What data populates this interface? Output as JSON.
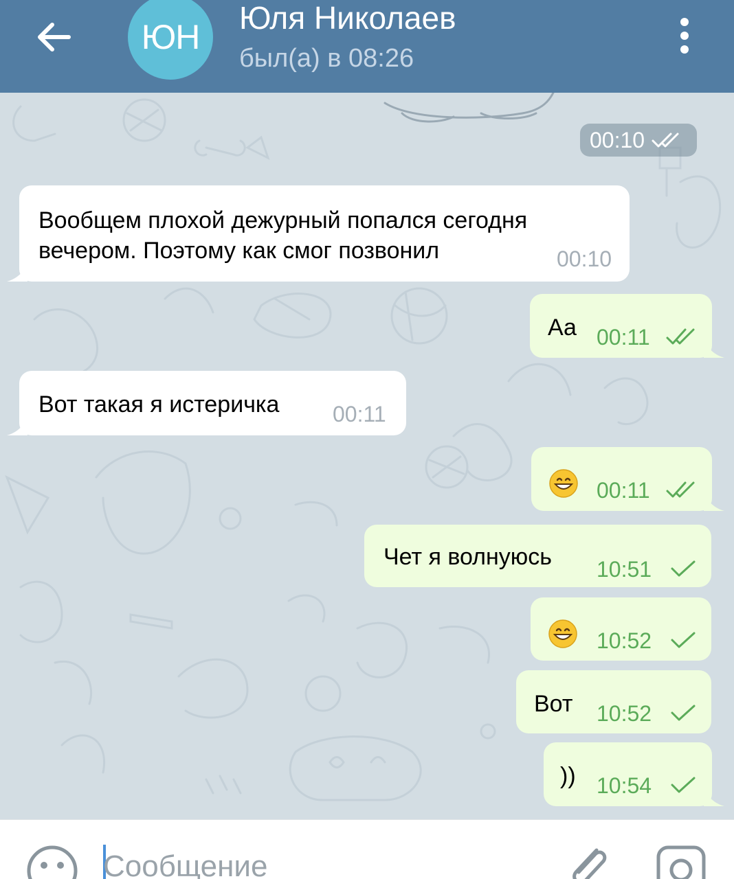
{
  "header": {
    "avatar_initials": "ЮН",
    "name": "Юля Николаев",
    "status": "был(а) в 08:26",
    "color": "#527da3",
    "avatar_color": "#5fbfd8",
    "icons": [
      "back-arrow-icon",
      "more-vertical-icon"
    ]
  },
  "messages": {
    "m0_time": "00:10",
    "m1": {
      "text_line1": "Вообщем плохой дежурный попался сегодня",
      "text_line2": "вечером. Поэтому как смог позвонил",
      "time": "00:10",
      "direction": "in"
    },
    "m2": {
      "text": "Аа",
      "time": "00:11",
      "direction": "out",
      "status": "read"
    },
    "m3": {
      "text": "Вот такая я истеричка",
      "time": "00:11",
      "direction": "in"
    },
    "m4": {
      "text": "😄",
      "time": "00:11",
      "direction": "out",
      "status": "read"
    },
    "m5": {
      "text": "Чет я волнуюсь",
      "time": "10:51",
      "direction": "out",
      "status": "sent"
    },
    "m6": {
      "text": "😄",
      "time": "10:52",
      "direction": "out",
      "status": "sent"
    },
    "m7": {
      "text": "Вот",
      "time": "10:52",
      "direction": "out",
      "status": "sent"
    },
    "m8": {
      "text": "))",
      "time": "10:54",
      "direction": "out",
      "status": "sent"
    }
  },
  "composer": {
    "placeholder": "Сообщение",
    "icons": [
      "emoji-icon",
      "attach-icon",
      "camera-icon"
    ]
  },
  "colors": {
    "incoming_bubble": "#ffffff",
    "outgoing_bubble": "#effdde",
    "outgoing_time": "#5bab59",
    "incoming_time": "#a5aeb6"
  }
}
